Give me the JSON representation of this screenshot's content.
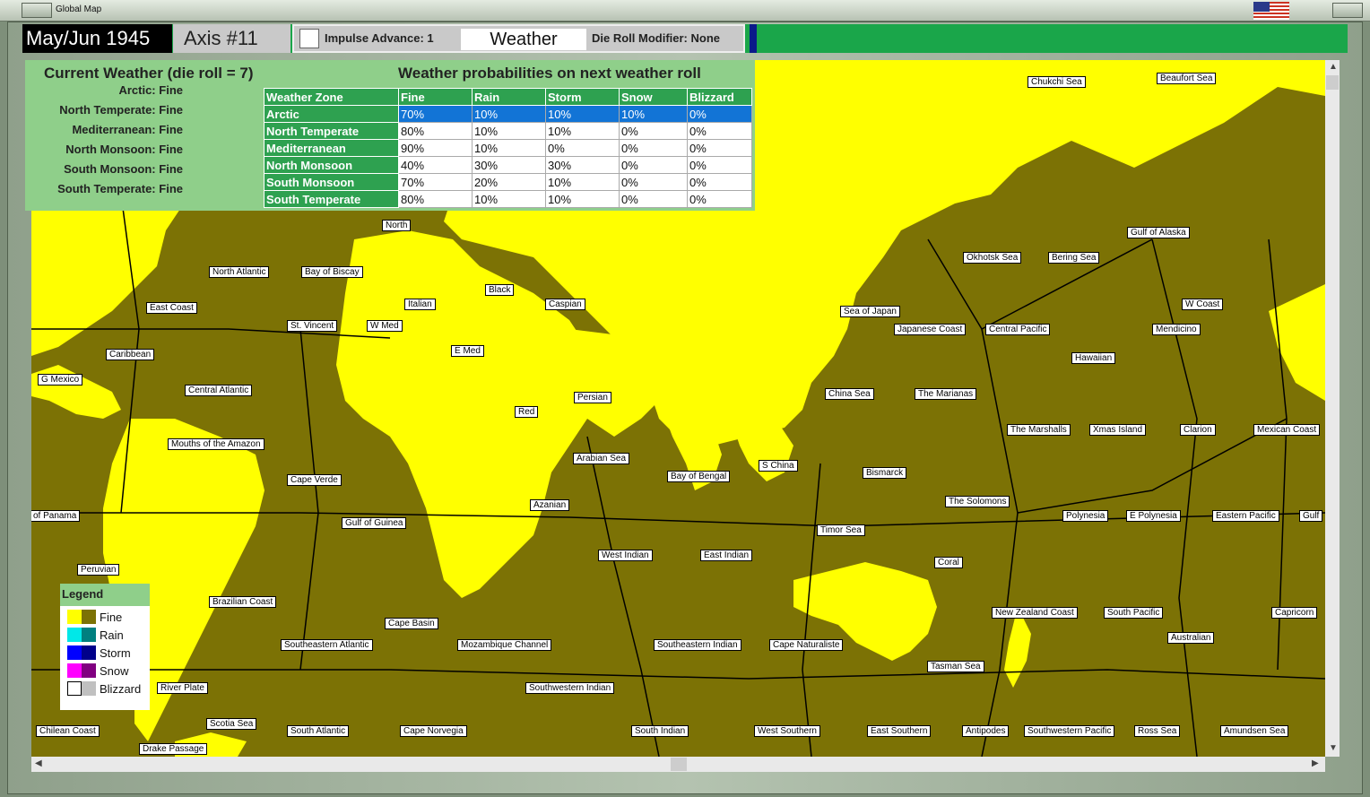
{
  "window": {
    "title": "Global Map"
  },
  "header": {
    "date": "May/Jun 1945",
    "turn": "Axis #11",
    "impulse_label": "Impulse Advance:",
    "impulse_value": "1",
    "weather_button": "Weather",
    "drm_label": "Die Roll Modifier:",
    "drm_value": "None"
  },
  "current_weather": {
    "title": "Current Weather (die roll = 7)",
    "zones": [
      {
        "name": "Arctic:",
        "value": "Fine"
      },
      {
        "name": "North Temperate:",
        "value": "Fine"
      },
      {
        "name": "Mediterranean:",
        "value": "Fine"
      },
      {
        "name": "North Monsoon:",
        "value": "Fine"
      },
      {
        "name": "South Monsoon:",
        "value": "Fine"
      },
      {
        "name": "South Temperate:",
        "value": "Fine"
      }
    ]
  },
  "probabilities": {
    "title": "Weather probabilities on next weather roll",
    "columns": [
      "Weather Zone",
      "Fine",
      "Rain",
      "Storm",
      "Snow",
      "Blizzard"
    ],
    "rows": [
      [
        "Arctic",
        "70%",
        "10%",
        "10%",
        "10%",
        "0%"
      ],
      [
        "North Temperate",
        "80%",
        "10%",
        "10%",
        "0%",
        "0%"
      ],
      [
        "Mediterranean",
        "90%",
        "10%",
        "0%",
        "0%",
        "0%"
      ],
      [
        "North Monsoon",
        "40%",
        "30%",
        "30%",
        "0%",
        "0%"
      ],
      [
        "South Monsoon",
        "70%",
        "20%",
        "10%",
        "0%",
        "0%"
      ],
      [
        "South Temperate",
        "80%",
        "10%",
        "10%",
        "0%",
        "0%"
      ]
    ],
    "selected_row": "Arctic"
  },
  "legend": {
    "title": "Legend",
    "items": [
      {
        "label": "Fine",
        "land": "#ffff00",
        "sea": "#7c7205"
      },
      {
        "label": "Rain",
        "land": "#00e8e8",
        "sea": "#008080"
      },
      {
        "label": "Storm",
        "land": "#0000ff",
        "sea": "#00008a"
      },
      {
        "label": "Snow",
        "land": "#ff00ff",
        "sea": "#800080"
      },
      {
        "label": "Blizzard",
        "land": "#ffffff",
        "sea": "#c0c0c0"
      }
    ]
  },
  "colors": {
    "land_fine": "#ffff00",
    "sea_fine": "#7c7205",
    "panel_green": "#8fcf8a",
    "header_green": "#2ea150",
    "selection_blue": "#1274d6"
  },
  "map_labels": [
    "Chukchi Sea",
    "Beaufort Sea",
    "North",
    "Gulf of Alaska",
    "North Atlantic",
    "Bay of Biscay",
    "Okhotsk Sea",
    "Bering Sea",
    "Black",
    "Italian",
    "Caspian",
    "East Coast",
    "W Coast",
    "Sea of Japan",
    "St. Vincent",
    "W Med",
    "Japanese Coast",
    "Central Pacific",
    "Mendicino",
    "E Med",
    "Caribbean",
    "Hawaiian",
    "G Mexico",
    "Central Atlantic",
    "China Sea",
    "The Marianas",
    "Persian",
    "Red",
    "The Marshalls",
    "Xmas Island",
    "Clarion",
    "Mexican Coast",
    "Mouths of the Amazon",
    "Arabian Sea",
    "S China",
    "Bismarck",
    "Cape Verde",
    "Bay of Bengal",
    "The Solomons",
    "Azanian",
    "of Panama",
    "Gulf of Guinea",
    "Polynesia",
    "E Polynesia",
    "Eastern Pacific",
    "Gulf",
    "Timor Sea",
    "West Indian",
    "East Indian",
    "Peruvian",
    "Coral",
    "Brazilian Coast",
    "New Zealand Coast",
    "South Pacific",
    "Capricorn",
    "Cape Basin",
    "Southeastern Atlantic",
    "Mozambique Channel",
    "Southeastern Indian",
    "Cape Naturaliste",
    "Australian",
    "Tasman Sea",
    "River Plate",
    "Southwestern Indian",
    "Scotia Sea",
    "Chilean Coast",
    "South Atlantic",
    "Cape Norvegia",
    "South Indian",
    "West Southern",
    "East Southern",
    "Antipodes",
    "Southwestern Pacific",
    "Ross Sea",
    "Amundsen Sea",
    "Drake Passage"
  ]
}
